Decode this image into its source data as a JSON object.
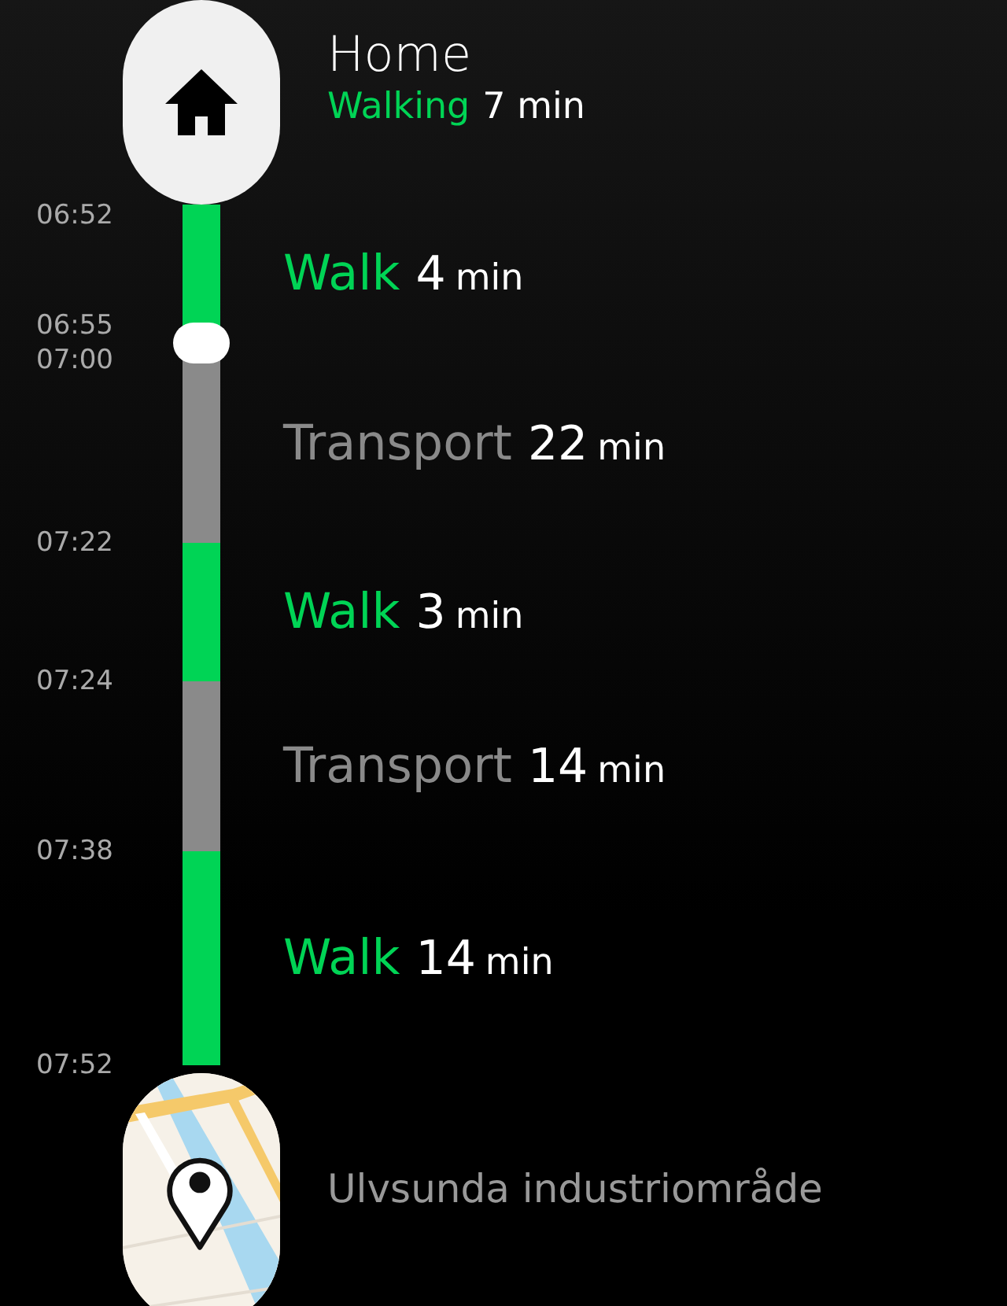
{
  "origin": {
    "name": "Home",
    "mode": "Walking",
    "duration": "7 min"
  },
  "segments": [
    {
      "kind": "walk",
      "label": "Walk",
      "value": "4",
      "unit": "min",
      "times": [
        "06:52"
      ],
      "stop": false
    },
    {
      "kind": "transport",
      "label": "Transport",
      "value": "22",
      "unit": "min",
      "times": [
        "06:55",
        "07:00"
      ],
      "stop": true
    },
    {
      "kind": "walk",
      "label": "Walk",
      "value": "3",
      "unit": "min",
      "times": [
        "07:22"
      ],
      "stop": false
    },
    {
      "kind": "transport",
      "label": "Transport",
      "value": "14",
      "unit": "min",
      "times": [
        "07:24"
      ],
      "stop": false
    },
    {
      "kind": "walk",
      "label": "Walk",
      "value": "14",
      "unit": "min",
      "times": [
        "07:38"
      ],
      "stop": false
    }
  ],
  "destination": {
    "time": "07:52",
    "name": "Ulvsunda industriområde"
  }
}
